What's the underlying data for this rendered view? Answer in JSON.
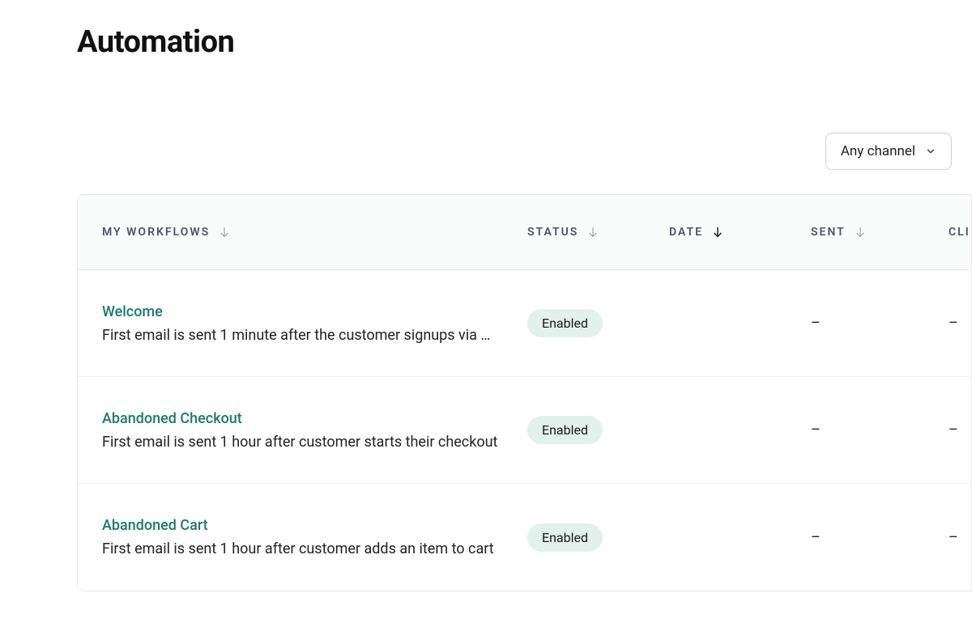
{
  "page": {
    "title": "Automation"
  },
  "filters": {
    "channel_label": "Any channel"
  },
  "table": {
    "columns": {
      "workflows": "MY WORKFLOWS",
      "status": "STATUS",
      "date": "DATE",
      "sent": "SENT",
      "click": "CLI"
    },
    "rows": [
      {
        "title": "Welcome",
        "description": "First email is sent 1 minute after the customer signups via …",
        "status": "Enabled",
        "sent": "–",
        "click": "–"
      },
      {
        "title": "Abandoned Checkout",
        "description": "First email is sent 1 hour after customer starts their checkout",
        "status": "Enabled",
        "sent": "–",
        "click": "–"
      },
      {
        "title": "Abandoned Cart",
        "description": "First email is sent 1 hour after customer adds an item to cart",
        "status": "Enabled",
        "sent": "–",
        "click": "–"
      }
    ]
  }
}
